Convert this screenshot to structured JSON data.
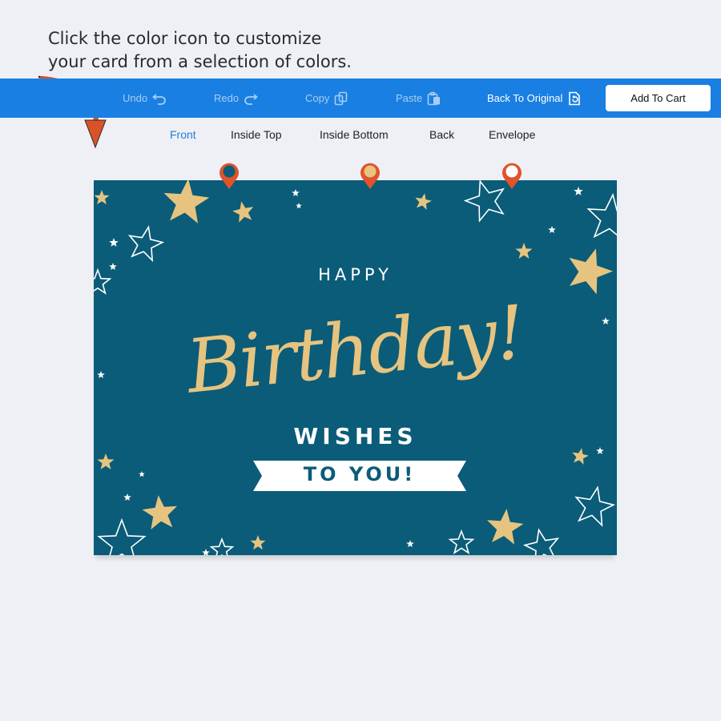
{
  "instructions": {
    "line1": "Click the color icon to customize",
    "line2": "your card from a selection of colors."
  },
  "toolbar": {
    "undo_label": "Undo",
    "redo_label": "Redo",
    "copy_label": "Copy",
    "paste_label": "Paste",
    "back_to_original_label": "Back To Original",
    "add_to_cart_label": "Add To Cart",
    "icons": [
      "undo-icon",
      "redo-icon",
      "copy-icon",
      "paste-icon",
      "revert-icon"
    ]
  },
  "tabs": [
    "Front",
    "Inside Top",
    "Inside Bottom",
    "Back",
    "Envelope"
  ],
  "active_tab": "Front",
  "card": {
    "line_happy": "HAPPY",
    "line_birthday": "Birthday!",
    "line_wishes": "WISHES",
    "line_to_you": "TO YOU!"
  },
  "color_pins": [
    {
      "name": "color-pin-background",
      "fill": "#0b5c78"
    },
    {
      "name": "color-pin-gold",
      "fill": "#e6c47f"
    },
    {
      "name": "color-pin-white",
      "fill": "#ffffff"
    }
  ],
  "colors": {
    "toolbar": "#1a7fe2",
    "accent": "#1a7fe2",
    "card_background": "#0b5c78",
    "gold": "#e6c47f",
    "pin_ring": "#e0532b",
    "arrow": "#d9522a"
  }
}
